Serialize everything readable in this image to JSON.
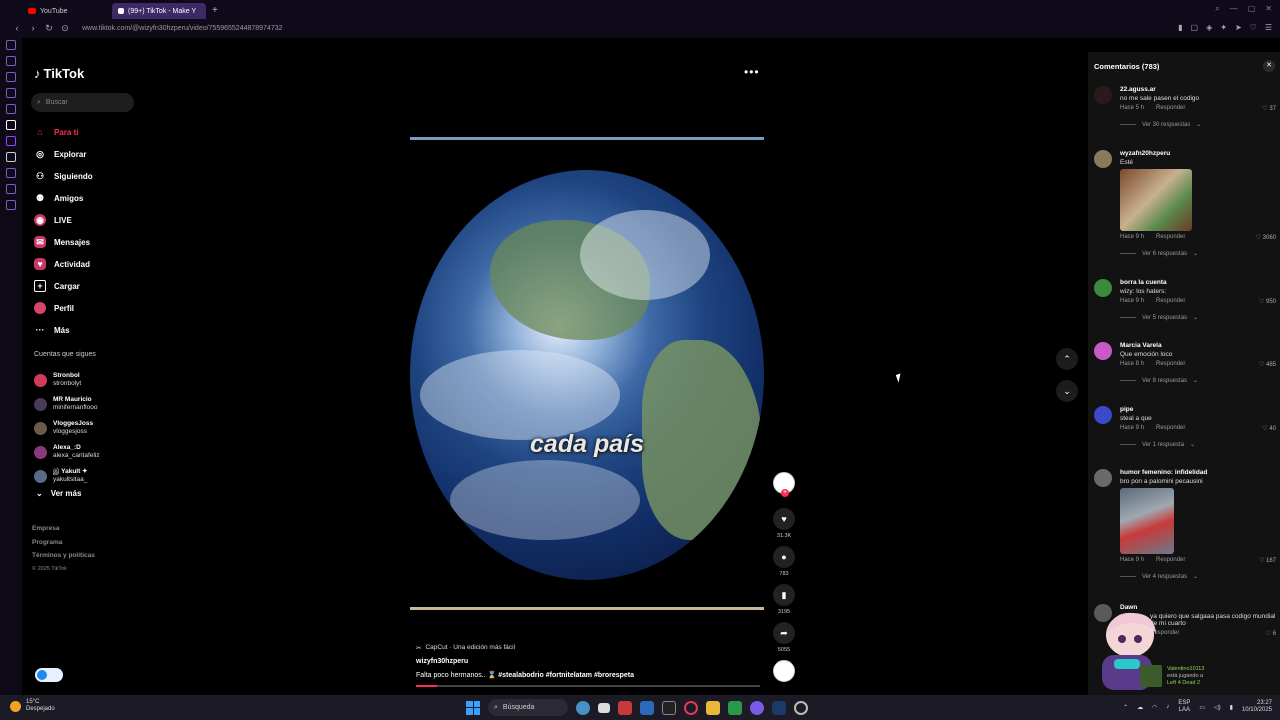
{
  "browser": {
    "tabs": [
      {
        "label": "YouTube",
        "color": "#ff0000"
      },
      {
        "label": "(99+) TikTok - Make Y",
        "color": "#ffffff"
      }
    ],
    "url": "www.tiktok.com/@wizyfn30hzperu/video/7559655244878974732"
  },
  "sidebar": {
    "logo": "TikTok",
    "search_placeholder": "Buscar",
    "nav": [
      {
        "label": "Para ti",
        "icon": "home-icon",
        "active": true
      },
      {
        "label": "Explorar",
        "icon": "compass-icon"
      },
      {
        "label": "Siguiendo",
        "icon": "following-icon"
      },
      {
        "label": "Amigos",
        "icon": "friends-icon"
      },
      {
        "label": "LIVE",
        "icon": "live-icon"
      },
      {
        "label": "Mensajes",
        "icon": "messages-icon"
      },
      {
        "label": "Actividad",
        "icon": "activity-icon"
      },
      {
        "label": "Cargar",
        "icon": "upload-icon"
      },
      {
        "label": "Perfil",
        "icon": "profile-icon"
      },
      {
        "label": "Más",
        "icon": "more-icon"
      }
    ],
    "following_title": "Cuentas que sigues",
    "following": [
      {
        "name": "Stronbol",
        "handle": "stronbolyt",
        "color": "#d23a5a"
      },
      {
        "name": "MR Mauricio",
        "handle": "minifernanflooo",
        "color": "#4a3a5a"
      },
      {
        "name": "VloggesJoss",
        "handle": "vloggesjoss",
        "color": "#6a5a4a"
      },
      {
        "name": "Alexa_:D",
        "handle": "alexa_caritafeliz",
        "color": "#8a3a7a"
      },
      {
        "name": "இ Yakult ✦",
        "handle": "yakultsitaa_",
        "color": "#5a6a8a"
      }
    ],
    "ver_mas": "Ver más",
    "footer": [
      "Empresa",
      "Programa",
      "Términos y políticas"
    ],
    "copyright": "© 2025 TikTok"
  },
  "video": {
    "caption_overlay": "cada país",
    "capcut": "CapCut · Una edición más fácil",
    "author": "wizyfn30hzperu",
    "description": "Falta poco hermanos.. ⌛",
    "hashtags": "#stealabodrio #fortnitelatam #brorespeta",
    "progress": 0.06
  },
  "actions": {
    "likes": "31.3K",
    "comments": "783",
    "saves": "3195",
    "shares": "5055"
  },
  "comments_panel": {
    "title": "Comentarios (783)",
    "items": [
      {
        "user": "22.aguss.ar",
        "text": "no me sale pasen el codigo",
        "time": "Hace 5 h",
        "reply": "Responder",
        "likes": "37",
        "replies": "Ver 30 respuestas",
        "avatar": "#2a1a1a"
      },
      {
        "user": "wyzafn20hzperu",
        "text": "Esté",
        "time": "Hace 9 h",
        "reply": "Responder",
        "likes": "3060",
        "replies": "Ver 6 respuestas",
        "avatar": "#8a7a5a"
      },
      {
        "user": "borra la cuenta",
        "text": "wizy: los haters:",
        "time": "Hace 9 h",
        "reply": "Responder",
        "likes": "950",
        "replies": "Ver 5 respuestas",
        "avatar": "#3a8a3a"
      },
      {
        "user": "Marcia Varela",
        "text": "Que emoción loco",
        "time": "Hace 8 h",
        "reply": "Responder",
        "likes": "485",
        "replies": "Ver 8 respuestas",
        "avatar": "#c85ac8"
      },
      {
        "user": "pipe",
        "text": "steal a que",
        "time": "Hace 9 h",
        "reply": "Responder",
        "likes": "40",
        "replies": "Ver 1 respuesta",
        "avatar": "#3a4ac8"
      },
      {
        "user": "humor femenino: infidelidad",
        "text": "bro pon a palomini pecausini",
        "time": "Hace 9 h",
        "reply": "Responder",
        "likes": "167",
        "replies": "Ver 4 respuestas",
        "avatar": "#6a6a6a"
      },
      {
        "user": "Dawn",
        "text": "ya quiero que salgaaa pasa codigo mundial de mi cuarto",
        "time": "",
        "reply": "Responder",
        "likes": "6",
        "replies": "",
        "avatar": "#5a5a5a"
      }
    ]
  },
  "notification": {
    "name": "Valentino10113",
    "status": "está jugando a",
    "game": "Left 4 Dead 2"
  },
  "taskbar": {
    "temp": "15°C",
    "weather": "Despejado",
    "search": "Búsqueda",
    "lang_top": "ESP",
    "lang_bottom": "LAA",
    "time": "23:27",
    "date": "10/10/2025"
  }
}
